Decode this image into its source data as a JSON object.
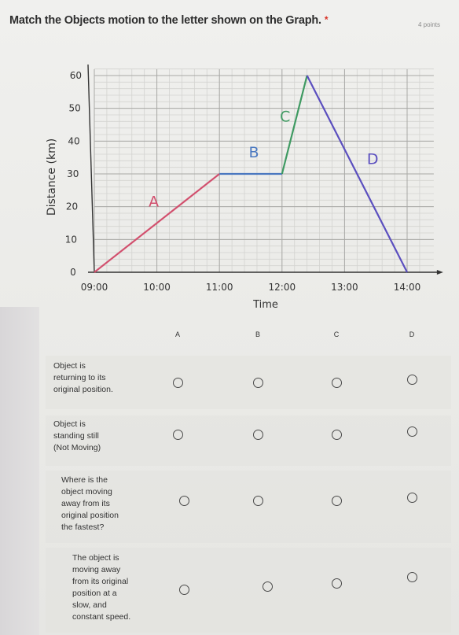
{
  "question": {
    "title": "Match the Objects motion to the letter shown on the Graph.",
    "required_marker": "*",
    "points": "4 points"
  },
  "chart_data": {
    "type": "line",
    "title": "",
    "xlabel": "Time",
    "ylabel": "Distance (km)",
    "x_ticks": [
      "09:00",
      "10:00",
      "11:00",
      "12:00",
      "13:00",
      "14:00"
    ],
    "y_ticks": [
      "0",
      "10",
      "20",
      "30",
      "40",
      "50",
      "60"
    ],
    "ylim": [
      0,
      60
    ],
    "xlim_hours": [
      9,
      14.3
    ],
    "grid": true,
    "series": [
      {
        "name": "A",
        "color": "#d2506e",
        "x_hours": [
          9,
          11
        ],
        "y": [
          0,
          30
        ]
      },
      {
        "name": "B",
        "color": "#4a78c0",
        "x_hours": [
          11,
          12
        ],
        "y": [
          30,
          30
        ]
      },
      {
        "name": "C",
        "color": "#3f9a62",
        "x_hours": [
          12,
          12.4
        ],
        "y": [
          30,
          60
        ]
      },
      {
        "name": "D",
        "color": "#5b4fbf",
        "x_hours": [
          12.4,
          14
        ],
        "y": [
          60,
          0
        ]
      }
    ],
    "annotations": [
      {
        "text": "A",
        "color": "#d2506e",
        "x_hours": 9.95,
        "y": 20
      },
      {
        "text": "B",
        "color": "#4a78c0",
        "x_hours": 11.55,
        "y": 35
      },
      {
        "text": "C",
        "color": "#3f9a62",
        "x_hours": 12.05,
        "y": 46
      },
      {
        "text": "D",
        "color": "#5b4fbf",
        "x_hours": 13.45,
        "y": 33
      }
    ]
  },
  "grid_question": {
    "columns": [
      "A",
      "B",
      "C",
      "D"
    ],
    "rows": [
      {
        "label": "Object is\nreturning to its\noriginal position.",
        "selected": null
      },
      {
        "label": "Object is\nstanding still\n(Not Moving)",
        "selected": null
      },
      {
        "label": "Where is the\nobject moving\naway from its\noriginal position\nthe fastest?",
        "selected": null
      },
      {
        "label": "The object is\nmoving away\nfrom its original\nposition at a\nslow, and\nconstant speed.",
        "selected": null
      }
    ]
  }
}
